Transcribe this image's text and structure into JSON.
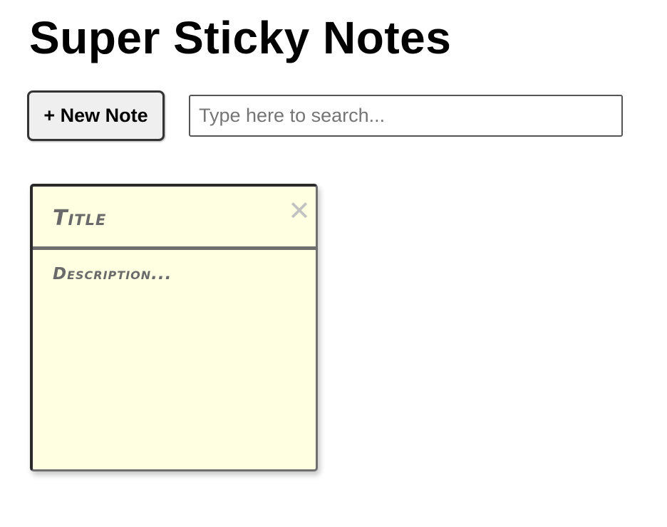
{
  "header": {
    "title": "Super Sticky Notes"
  },
  "toolbar": {
    "new_note_label": "+ New Note",
    "search": {
      "value": "",
      "placeholder": "Type here to search..."
    }
  },
  "notes": [
    {
      "title_value": "",
      "title_placeholder": "Title",
      "description_value": "",
      "description_placeholder": "Description...",
      "close_glyph": "✕",
      "close_icon": "close-icon",
      "background_color": "#ffffe2"
    }
  ]
}
